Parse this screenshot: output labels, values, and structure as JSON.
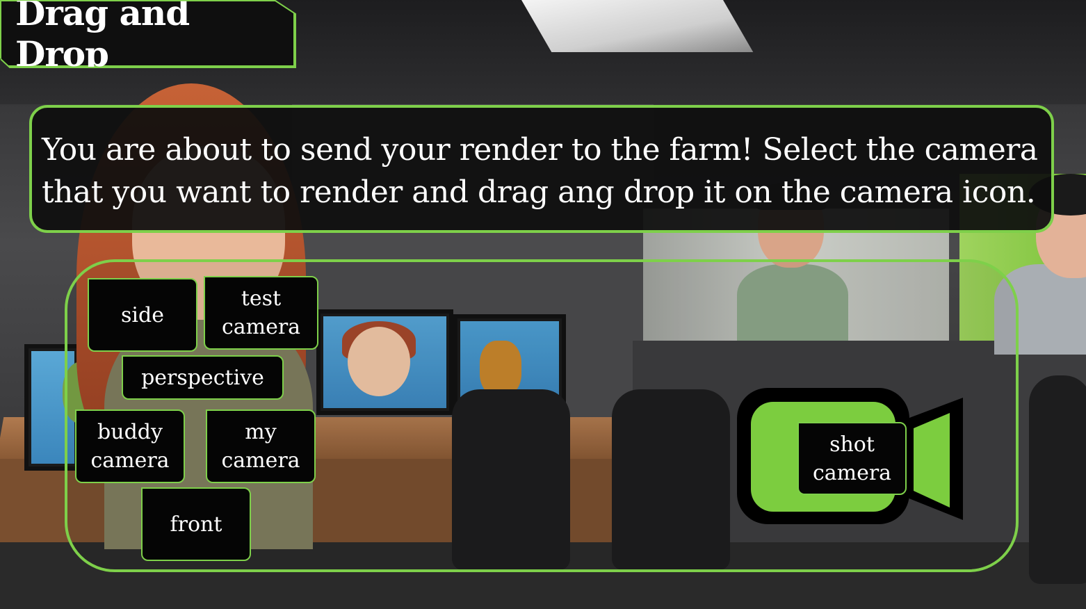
{
  "title": "Drag and Drop",
  "instructions": "You are about to send your render to the farm! Select the camera that you want to render and drag ang drop it on the camera icon.",
  "cameras": {
    "side": "side",
    "test_camera": "test\ncamera",
    "perspective": "perspective",
    "buddy_camera": "buddy\ncamera",
    "my_camera": "my\ncamera",
    "front": "front",
    "shot_camera": "shot\ncamera"
  },
  "drop_target_icon": "video-camera-icon",
  "colors": {
    "accent_green": "#7ed04a",
    "camera_green": "#7ccd3f",
    "tile_bg": "#050505",
    "text": "#ffffff"
  }
}
